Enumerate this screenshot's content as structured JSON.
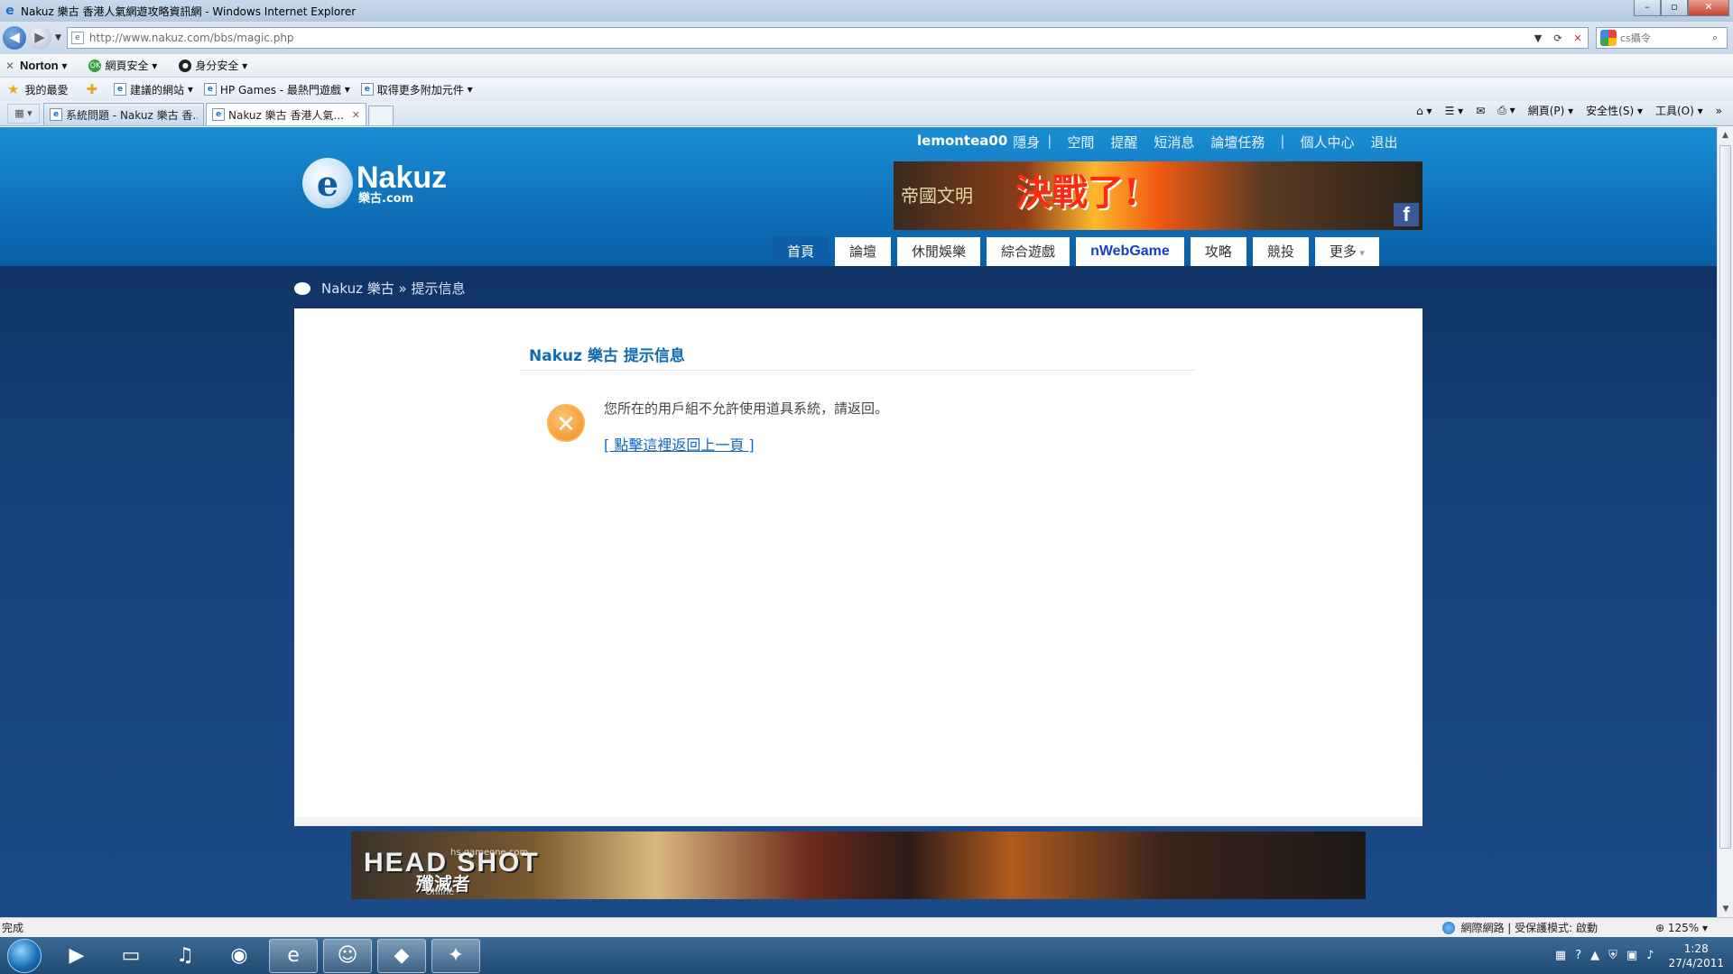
{
  "window": {
    "title": "Nakuz 樂古 香港人氣網遊攻略資訊網 - Windows Internet Explorer",
    "address": "http://www.nakuz.com/bbs/magic.php",
    "search_placeholder": "cs攝令"
  },
  "norton_bar": {
    "brand": "Norton",
    "web_safety": "網頁安全",
    "identity_safety": "身分安全"
  },
  "favorites_bar": {
    "favorites": "我的最愛",
    "items": [
      "建議的網站",
      "HP Games - 最熱門遊戲",
      "取得更多附加元件"
    ]
  },
  "tabs": [
    {
      "label": "系統問題 - Nakuz 樂古 香..."
    },
    {
      "label": "Nakuz 樂古 香港人氣..."
    }
  ],
  "command_bar": {
    "page": "網頁(P)",
    "safety": "安全性(S)",
    "tools": "工具(O)"
  },
  "site": {
    "username": "lemontea00",
    "top_links": [
      "隱身",
      "空間",
      "提醒",
      "短消息",
      "論壇任務",
      "個人中心",
      "退出"
    ],
    "logo_text": "Nakuz",
    "logo_sub": "樂古.com",
    "nav": [
      "首頁",
      "論壇",
      "休閒娛樂",
      "綜合遊戲",
      "nWebGame",
      "攻略",
      "競投",
      "更多"
    ],
    "breadcrumb": "Nakuz 樂古 » 提示信息",
    "banner_top": {
      "title": "決戰了!",
      "game": "帝國文明"
    },
    "banner_bottom": {
      "title": "HEAD SHOT",
      "cn": "殲滅者",
      "sub": "Online",
      "site": "hs.gameone.com"
    }
  },
  "notice": {
    "title": "Nakuz 樂古 提示信息",
    "message": "您所在的用戶組不允許使用道具系統，請返回。",
    "back_link": "[ 點擊這裡返回上一頁 ]"
  },
  "status_bar": {
    "text": "完成",
    "zone": "網際網路 | 受保護模式: 啟動",
    "zoom": "125%"
  },
  "taskbar": {
    "time": "1:28",
    "date": "27/4/2011"
  }
}
